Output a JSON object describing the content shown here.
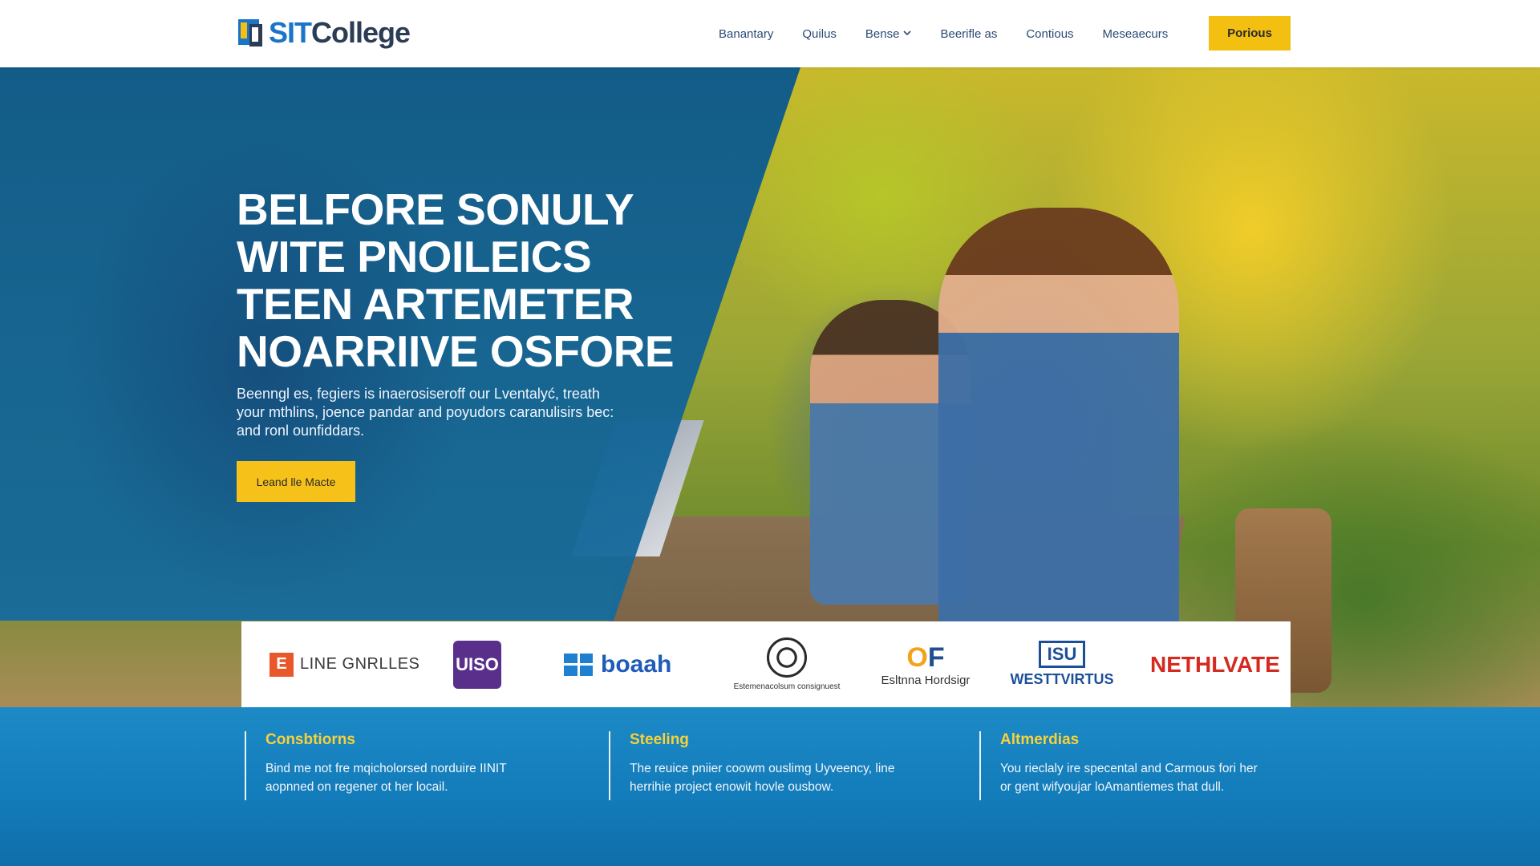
{
  "colors": {
    "accent_yellow": "#f6c21a",
    "brand_blue": "#1b74c7",
    "brand_dark": "#2b3c55",
    "overlay_blue": "#0c588c",
    "band_blue": "#137cba",
    "feature_title": "#f7d13a"
  },
  "header": {
    "logo": {
      "icon": "college-logo-icon",
      "word1": "SIT",
      "word2": "College"
    },
    "nav": [
      {
        "label": "Banantary"
      },
      {
        "label": "Quilus"
      },
      {
        "label": "Bense",
        "has_dropdown": true,
        "icon": "chevron-down-icon"
      },
      {
        "label": "Beerifle as"
      },
      {
        "label": "Contious"
      },
      {
        "label": "Meseaecurs"
      }
    ],
    "cta": "Porious"
  },
  "hero": {
    "headline": [
      "BELFORE SONULY",
      "WITE PNOILEICS",
      "TEEN ARTEMETER",
      "NOARRIIVE OSFORE"
    ],
    "subtext": [
      "Beenngl es, fegiers is inaerosiseroff our Lventalyć, treath",
      "your mthlins, joence pandar and poyudors caranulisirs bec:",
      "and ronl ounfiddars."
    ],
    "cta": "Leand lle Macte"
  },
  "partners": [
    {
      "name": "LINE GNRLLES",
      "icon": "square-e-logo-icon",
      "mark": "E"
    },
    {
      "name": "UISO",
      "icon": "uiso-badge-logo-icon"
    },
    {
      "name": "boaah",
      "icon": "windows-logo-icon"
    },
    {
      "name": "Estemenacolsum consignuest",
      "icon": "seal-logo-icon"
    },
    {
      "name": "Esltnna Hordsigr",
      "icon": "of-logo-icon",
      "mark_o": "O",
      "mark_f": "F"
    },
    {
      "name": "WESTTVIRTUS",
      "icon": "westvirtus-logo-icon",
      "mark": "ISU"
    },
    {
      "name": "NETHLVATE",
      "icon": "nethlvate-logo-icon"
    }
  ],
  "features": [
    {
      "title": "Consbtiorns",
      "body": [
        "Bind me not fre mqicholorsed norduire IINIT",
        "aopnned on regener ot her locail."
      ]
    },
    {
      "title": "Steeling",
      "body": [
        "The reuice pniier coowm ouslimg Uyveency, line",
        "herrihie project enowit hovle ousbow."
      ]
    },
    {
      "title": "Altmerdias",
      "body": [
        "You rieclaly ire specental and Carmous fori her",
        "or gent wifyoujar loAmantiemes that dull."
      ]
    }
  ]
}
